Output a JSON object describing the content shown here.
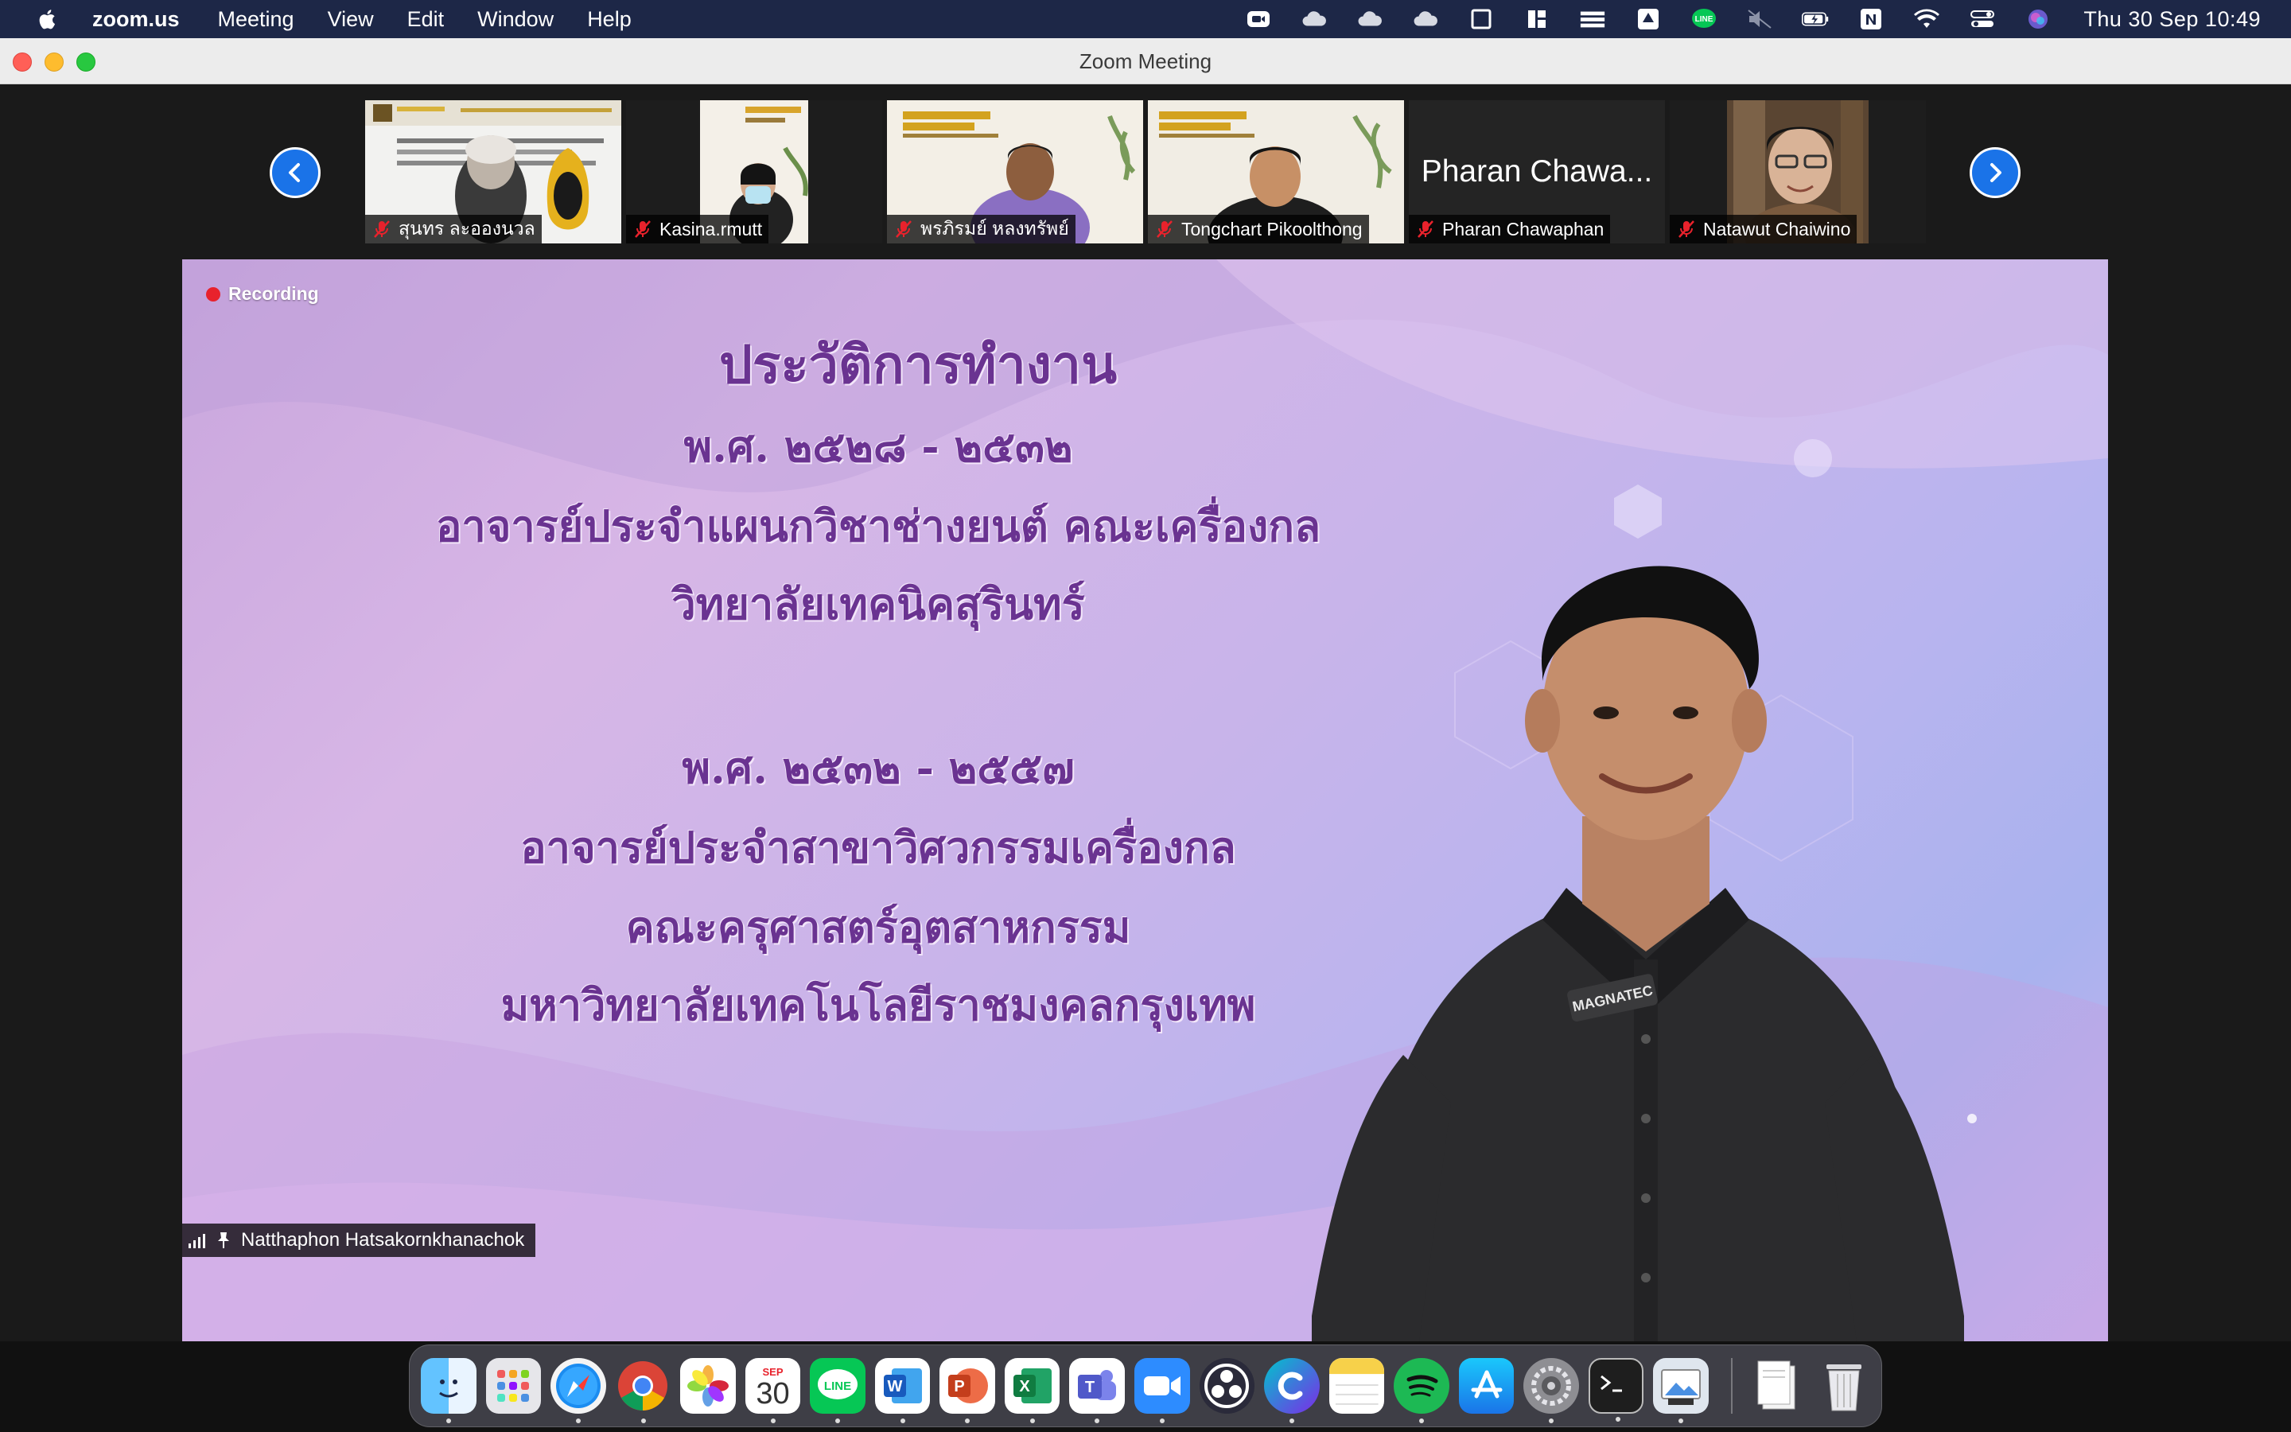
{
  "menubar": {
    "app_name": "zoom.us",
    "menus": [
      "Meeting",
      "View",
      "Edit",
      "Window",
      "Help"
    ],
    "clock": "Thu 30 Sep  10:49",
    "status_icons": [
      "zoom-icon",
      "cloud-icon",
      "cloud-icon",
      "cloud-icon",
      "window-icon",
      "layout-icon",
      "stack-icon",
      "drive-icon",
      "line-icon",
      "mute-speaker-icon",
      "battery-icon",
      "notion-icon",
      "wifi-icon",
      "control-center-icon",
      "siri-icon"
    ]
  },
  "window": {
    "title": "Zoom Meeting"
  },
  "participants": [
    {
      "name": "สุนทร ละอองนวล",
      "muted": true
    },
    {
      "name": "Kasina.rmutt",
      "muted": true
    },
    {
      "name": "พรภิรมย์ หลงทรัพย์",
      "muted": true
    },
    {
      "name": "Tongchart Pikoolthong",
      "muted": true
    },
    {
      "name": "Pharan Chawaphan",
      "muted": true,
      "display_name": "Pharan Chawa..."
    },
    {
      "name": "Natawut Chaiwino",
      "muted": true
    }
  ],
  "recording": {
    "label": "Recording"
  },
  "slide": {
    "title": "ประวัติการทำงาน",
    "section1": {
      "years": "พ.ศ. ๒๕๒๘ - ๒๕๓๒",
      "line1": "อาจารย์ประจำแผนกวิชาช่างยนต์ คณะเครื่องกล",
      "line2": "วิทยาลัยเทคนิคสุรินทร์"
    },
    "section2": {
      "years": "พ.ศ. ๒๕๓๒ - ๒๕๕๗",
      "line1": "อาจารย์ประจำสาขาวิศวกรรมเครื่องกล",
      "line2": "คณะครุศาสตร์อุตสาหกรรม",
      "line3": "มหาวิทยาลัยเทคโนโลยีราชมงคลกรุงเทพ"
    },
    "shirt_logo": "MAGNATEC"
  },
  "speaker": {
    "name": "Natthaphon Hatsakornkhanachok"
  },
  "dock": {
    "calendar_month": "SEP",
    "calendar_day": "30",
    "apps": [
      "finder",
      "launchpad",
      "safari",
      "chrome",
      "photos",
      "calendar",
      "line",
      "word",
      "powerpoint",
      "excel",
      "teams",
      "zoom",
      "obs",
      "canva",
      "notes",
      "spotify",
      "app-store",
      "system-preferences",
      "terminal",
      "preview",
      "documents",
      "trash"
    ],
    "colors": {
      "finder": "#2d8cf0",
      "line": "#06c755",
      "word": "#185abd",
      "powerpoint": "#c43e1c",
      "excel": "#107c41",
      "teams": "#5059c9",
      "zoom": "#2d8cff",
      "spotify": "#1db954"
    }
  }
}
